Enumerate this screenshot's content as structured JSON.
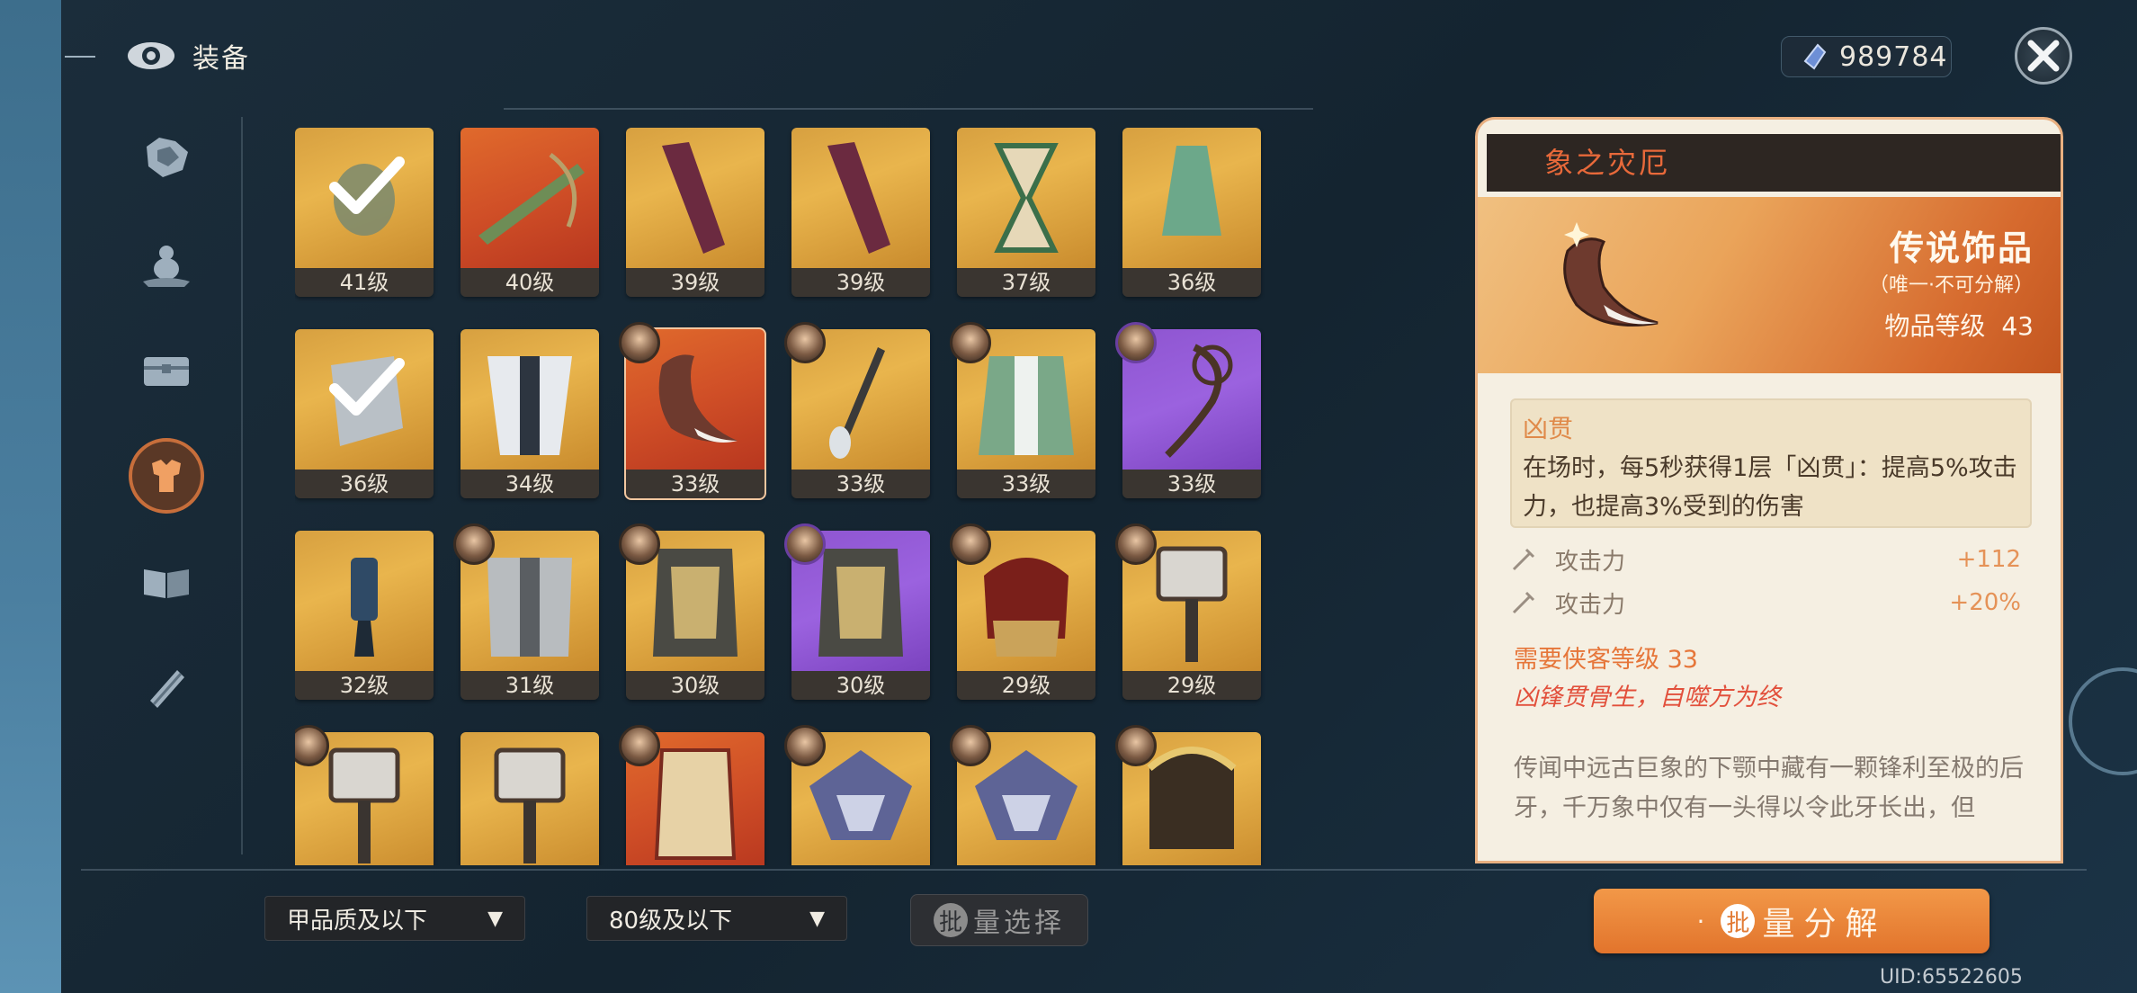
{
  "header": {
    "title": "装备"
  },
  "currency": {
    "value": "989784"
  },
  "sidebar": [
    {
      "icon": "gem-cluster-icon"
    },
    {
      "icon": "gourd-icon"
    },
    {
      "icon": "chest-icon"
    },
    {
      "icon": "armor-icon",
      "active": true
    },
    {
      "icon": "book-icon"
    },
    {
      "icon": "scroll-icon"
    }
  ],
  "items": [
    {
      "level": "41级",
      "rarity": "gold",
      "equipped": true
    },
    {
      "level": "40级",
      "rarity": "red"
    },
    {
      "level": "39级",
      "rarity": "gold"
    },
    {
      "level": "39级",
      "rarity": "gold"
    },
    {
      "level": "37级",
      "rarity": "gold"
    },
    {
      "level": "36级",
      "rarity": "gold"
    },
    {
      "level": "36级",
      "rarity": "gold",
      "equipped": true
    },
    {
      "level": "34级",
      "rarity": "gold"
    },
    {
      "level": "33级",
      "rarity": "red",
      "avatar": true,
      "selected": true
    },
    {
      "level": "33级",
      "rarity": "gold",
      "avatar": true
    },
    {
      "level": "33级",
      "rarity": "gold",
      "avatar": true
    },
    {
      "level": "33级",
      "rarity": "purple",
      "avatar": true
    },
    {
      "level": "32级",
      "rarity": "gold"
    },
    {
      "level": "31级",
      "rarity": "gold",
      "avatar": true
    },
    {
      "level": "30级",
      "rarity": "gold",
      "avatar": true
    },
    {
      "level": "30级",
      "rarity": "purple",
      "avatar": true
    },
    {
      "level": "29级",
      "rarity": "gold",
      "avatar": true
    },
    {
      "level": "29级",
      "rarity": "gold",
      "avatar": true
    },
    {
      "level": "",
      "rarity": "gold",
      "avatar": true
    },
    {
      "level": "",
      "rarity": "gold"
    },
    {
      "level": "",
      "rarity": "red",
      "avatar": true
    },
    {
      "level": "",
      "rarity": "gold",
      "avatar": true
    },
    {
      "level": "",
      "rarity": "gold",
      "avatar": true
    },
    {
      "level": "",
      "rarity": "gold",
      "avatar": true
    }
  ],
  "filters": {
    "quality": "甲品质及以下",
    "level": "80级及以下"
  },
  "batch_select": {
    "icon_char": "批",
    "label": "量选择"
  },
  "batch_decompose": {
    "icon_char": "批",
    "label": "量分解"
  },
  "uid": "UID:65522605",
  "detail": {
    "name": "象之灾厄",
    "rarity": "传说饰品",
    "rarity_note": "（唯一·不可分解）",
    "item_level_label": "物品等级",
    "item_level": "43",
    "skill_name": "凶贯",
    "skill_desc": "在场时，每5秒获得1层「凶贯」：提高5%攻击力，也提高3%受到的伤害",
    "stats": [
      {
        "name": "攻击力",
        "value": "+112"
      },
      {
        "name": "攻击力",
        "value": "+20%"
      }
    ],
    "requirement": "需要侠客等级 33",
    "motto": "凶锋贯骨生，自噬方为终",
    "lore": "传闻中远古巨象的下颚中藏有一颗锋利至极的后牙，千万象中仅有一头得以令此牙长出，但"
  }
}
